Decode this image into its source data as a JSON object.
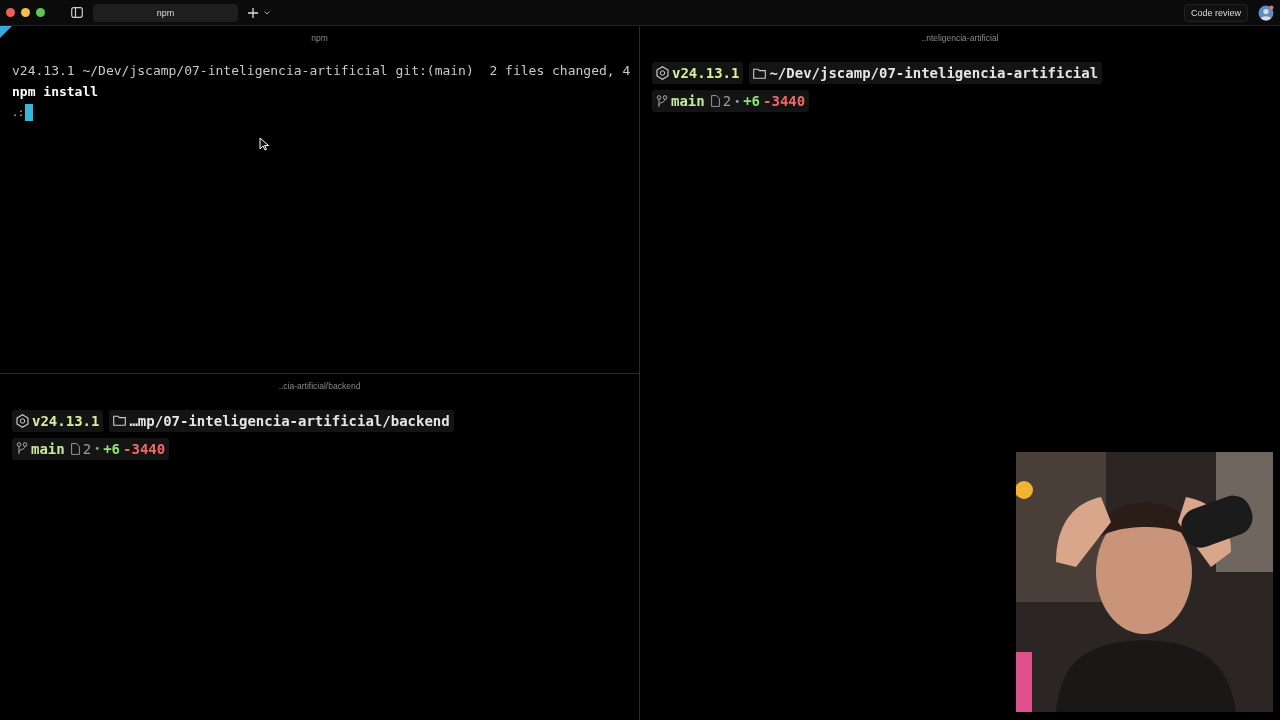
{
  "tab_bar": {
    "tabs": [
      {
        "label": "npm",
        "selected": true
      }
    ],
    "code_review_button": "Code review"
  },
  "panes": [
    {
      "title": "npm",
      "kind": "shell",
      "lines": [
        {
          "kind": "prompt",
          "text": "v24.13.1 ~/Dev/jscamp/07-inteligencia-artificial git:(main)  2 files changed, 4"
        },
        {
          "kind": "command",
          "text": "npm install"
        },
        {
          "kind": "progress",
          "text": ".:"
        }
      ],
      "cursor": true
    },
    {
      "title": "..cia-artificial/backend",
      "kind": "powerline",
      "node_version": "v24.13.1",
      "path": "…mp/07-inteligencia-artificial/backend",
      "branch": "main",
      "files": "2",
      "separator": "•",
      "added": "+6",
      "removed": "-3440"
    },
    {
      "title": "..nteligencia-artificial",
      "kind": "powerline",
      "node_version": "v24.13.1",
      "path": "~/Dev/jscamp/07-inteligencia-artificial",
      "branch": "main",
      "files": "2",
      "separator": "•",
      "added": "+6",
      "removed": "-3440"
    }
  ]
}
